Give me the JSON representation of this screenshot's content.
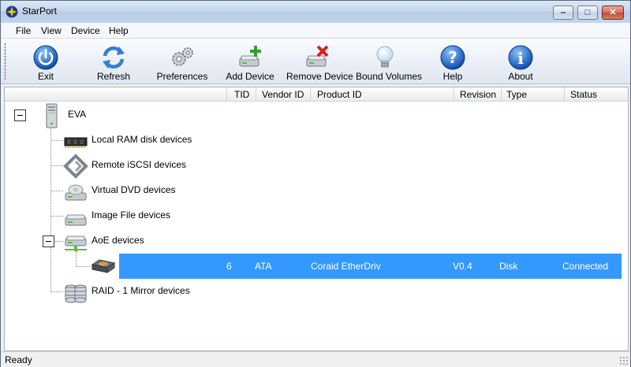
{
  "window": {
    "title": "StarPort"
  },
  "menu": [
    {
      "label": "File"
    },
    {
      "label": "View"
    },
    {
      "label": "Device"
    },
    {
      "label": "Help"
    }
  ],
  "toolbar": {
    "exit": {
      "label": "Exit",
      "icon": "power-icon"
    },
    "refresh": {
      "label": "Refresh",
      "icon": "refresh-icon"
    },
    "preferences": {
      "label": "Preferences",
      "icon": "gears-icon"
    },
    "add_device": {
      "label": "Add Device",
      "icon": "add-device-icon"
    },
    "remove_device": {
      "label": "Remove Device",
      "icon": "remove-device-icon"
    },
    "bound_volumes": {
      "label": "Bound Volumes",
      "icon": "lightbulb-icon"
    },
    "help": {
      "label": "Help",
      "icon": "help-icon"
    },
    "about": {
      "label": "About",
      "icon": "info-icon"
    }
  },
  "columns": [
    "TID",
    "Vendor ID",
    "Product ID",
    "Revision",
    "Type",
    "Status"
  ],
  "tree": {
    "root": {
      "label": "EVA"
    },
    "groups": [
      {
        "label": "Local RAM disk devices"
      },
      {
        "label": "Remote iSCSI devices"
      },
      {
        "label": "Virtual DVD devices"
      },
      {
        "label": "Image File devices"
      },
      {
        "label": "AoE devices"
      },
      {
        "label": "RAID - 1 Mirror devices"
      }
    ]
  },
  "device_row": {
    "tid": "6",
    "vendor_id": "ATA",
    "product_id": "Coraid EtherDriv",
    "revision": "V0.4",
    "type": "Disk",
    "status": "Connected"
  },
  "status_bar": {
    "text": "Ready"
  },
  "colors": {
    "selection": "#3399ff"
  }
}
